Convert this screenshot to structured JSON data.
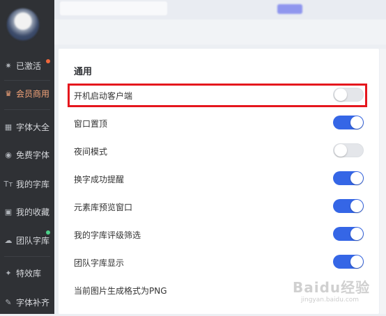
{
  "sidebar": {
    "items": [
      {
        "label": "已激活",
        "icon": "lightbulb-icon",
        "glyph": "✷"
      },
      {
        "label": "会员商用",
        "icon": "vip-badge-icon",
        "glyph": "♛"
      },
      {
        "label": "字体大全",
        "icon": "grid-icon",
        "glyph": "▦"
      },
      {
        "label": "免费字体",
        "icon": "globe-icon",
        "glyph": "◉"
      },
      {
        "label": "我的字库",
        "icon": "font-tt-icon",
        "glyph": "Tт"
      },
      {
        "label": "我的收藏",
        "icon": "folder-icon",
        "glyph": "▣"
      },
      {
        "label": "团队字库",
        "icon": "team-icon",
        "glyph": "☁"
      },
      {
        "label": "特效库",
        "icon": "effects-icon",
        "glyph": "✦"
      },
      {
        "label": "字体补齐",
        "icon": "wrench-icon",
        "glyph": "✎"
      }
    ],
    "active_index": 1,
    "active_color": "#f6a57a",
    "badge_colors": {
      "activated": "#f0683c",
      "team": "#4cd28a"
    }
  },
  "settings": {
    "section_title": "通用",
    "rows": [
      {
        "label": "开机启动客户端",
        "on": false,
        "highlighted": true
      },
      {
        "label": "窗口置顶",
        "on": true
      },
      {
        "label": "夜间模式",
        "on": false
      },
      {
        "label": "换字成功提醒",
        "on": true
      },
      {
        "label": "元素库预览窗口",
        "on": true
      },
      {
        "label": "我的字库评级筛选",
        "on": true
      },
      {
        "label": "团队字库显示",
        "on": true
      },
      {
        "label": "当前图片生成格式为PNG"
      }
    ],
    "toggle_on_color": "#3566e6",
    "highlight_color": "#e5161d"
  },
  "watermark": {
    "brand": "Baidu经验",
    "url": "jingyan.baidu.com"
  }
}
